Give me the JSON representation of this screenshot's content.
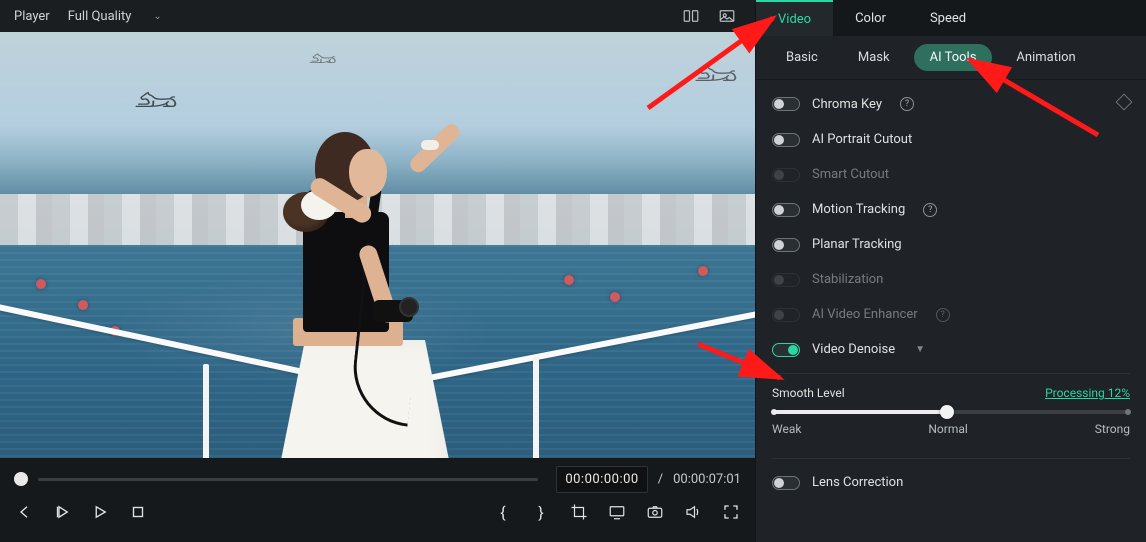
{
  "topbar": {
    "player_label": "Player",
    "quality": "Full Quality"
  },
  "timeline": {
    "current": "00:00:00:00",
    "separator": "/",
    "total": "00:00:07:01"
  },
  "main_tabs": {
    "video": "Video",
    "color": "Color",
    "speed": "Speed"
  },
  "sub_tabs": {
    "basic": "Basic",
    "mask": "Mask",
    "ai_tools": "AI Tools",
    "animation": "Animation"
  },
  "tools": {
    "chroma_key": "Chroma Key",
    "ai_portrait": "AI Portrait Cutout",
    "smart_cutout": "Smart Cutout",
    "motion_tracking": "Motion Tracking",
    "planar_tracking": "Planar Tracking",
    "stabilization": "Stabilization",
    "ai_enhancer": "AI Video Enhancer",
    "video_denoise": "Video Denoise",
    "lens_correction": "Lens Correction"
  },
  "denoise": {
    "title": "Smooth Level",
    "status": "Processing 12%",
    "weak": "Weak",
    "normal": "Normal",
    "strong": "Strong",
    "value_percent": 49
  }
}
